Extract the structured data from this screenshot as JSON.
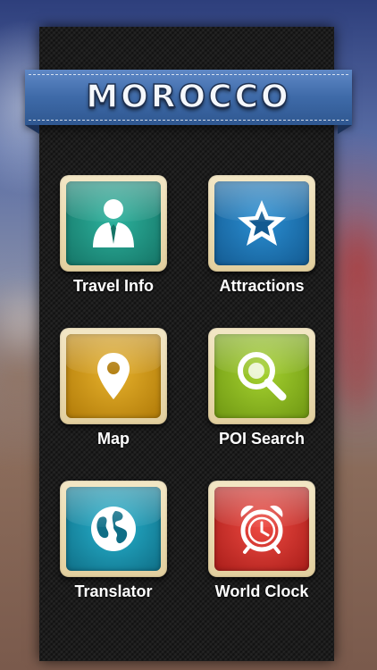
{
  "header": {
    "title": "MOROCCO"
  },
  "menu": [
    {
      "label": "Travel Info",
      "icon": "person-icon",
      "color": "#1e8f7e"
    },
    {
      "label": "Attractions",
      "icon": "star-icon",
      "color": "#1f74b6"
    },
    {
      "label": "Map",
      "icon": "map-pin-icon",
      "color": "#d49a14"
    },
    {
      "label": "POI Search",
      "icon": "magnifier-icon",
      "color": "#8dbb1f"
    },
    {
      "label": "Translator",
      "icon": "globe-icon",
      "color": "#1594b0"
    },
    {
      "label": "World Clock",
      "icon": "alarm-clock-icon",
      "color": "#d8312c"
    }
  ]
}
